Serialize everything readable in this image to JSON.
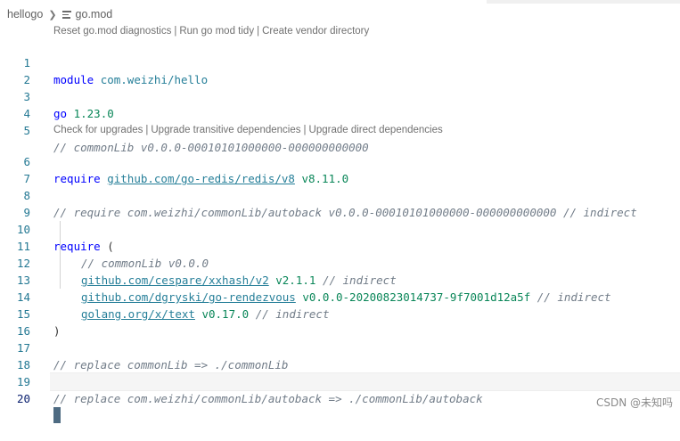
{
  "breadcrumb": {
    "folder": "hellogo",
    "file": "go.mod"
  },
  "lens_top": [
    "Reset go.mod diagnostics",
    "Run go mod tidy",
    "Create vendor directory"
  ],
  "lens_require": [
    "Check for upgrades",
    "Upgrade transitive dependencies",
    "Upgrade direct dependencies"
  ],
  "code": {
    "l1_kw": "module",
    "l1_val": "com.weizhi/hello",
    "l3_kw": "go",
    "l3_val": "1.23.0",
    "l5": "// commonLib v0.0.0-00010101000000-000000000000",
    "l6_kw": "require",
    "l6_mod": "github.com/go-redis/redis/v8",
    "l6_ver": "v8.11.0",
    "l8": "// require com.weizhi/commonLib/autoback v0.0.0-00010101000000-000000000000 // indirect",
    "l10_kw": "require",
    "l10_p": "(",
    "l11": "// commonLib v0.0.0",
    "l12_mod": "github.com/cespare/xxhash/v2",
    "l12_ver": "v2.1.1",
    "l12_cm": "// indirect",
    "l13_mod": "github.com/dgryski/go-rendezvous",
    "l13_ver": "v0.0.0-20200823014737-9f7001d12a5f",
    "l13_cm": "// indirect",
    "l14_mod": "golang.org/x/text",
    "l14_ver": "v0.17.0",
    "l14_cm": "// indirect",
    "l15": ")",
    "l17": "// replace commonLib => ./commonLib",
    "l19": "// replace com.weizhi/commonLib/autoback => ./commonLib/autoback"
  },
  "line_numbers": [
    "1",
    "2",
    "3",
    "4",
    "5",
    "6",
    "7",
    "8",
    "9",
    "10",
    "11",
    "12",
    "13",
    "14",
    "15",
    "16",
    "17",
    "18",
    "19",
    "20"
  ],
  "watermark": "CSDN @未知吗",
  "colors": {
    "line_number": "#237893",
    "keyword": "#0000ff",
    "module": "#267f99",
    "version": "#098658",
    "comment": "#717c88"
  }
}
